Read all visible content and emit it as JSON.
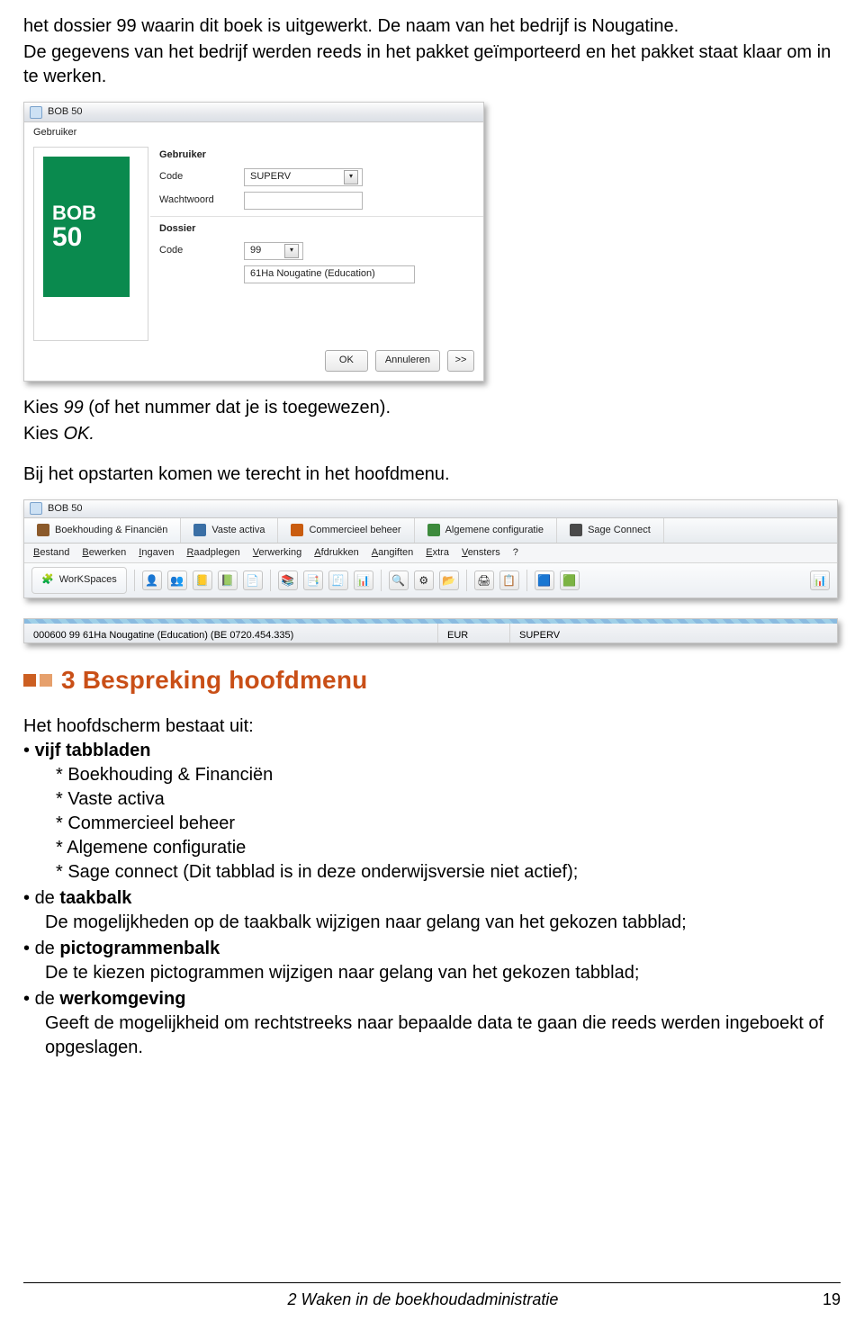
{
  "intro": {
    "line1": "het dossier 99 waarin dit boek is uitgewerkt. De naam van het bedrijf is Nougatine.",
    "line2": "De gegevens van het bedrijf werden reeds in het pakket geïmporteerd en het pakket staat klaar om in te werken."
  },
  "login": {
    "window_title": "BOB 50",
    "logo_top": "BOB",
    "logo_bottom": "50",
    "group_user": "Gebruiker",
    "lbl_code": "Code",
    "val_user_code": "SUPERV",
    "lbl_pwd": "Wachtwoord",
    "val_pwd": "",
    "group_dossier": "Dossier",
    "val_dossier_code": "99",
    "val_dossier_desc": "61Ha Nougatine (Education)",
    "btn_ok": "OK",
    "btn_cancel": "Annuleren",
    "btn_more": ">>"
  },
  "mid": {
    "line1a": "Kies ",
    "line1b": "99",
    "line1c": " (of het nummer dat je is toegewezen).",
    "line2a": "Kies ",
    "line2b": "OK.",
    "line3": "Bij het opstarten komen we terecht in het hoofdmenu."
  },
  "toolbar": {
    "window_title": "BOB 50",
    "tabs": [
      "Boekhouding & Financiën",
      "Vaste activa",
      "Commercieel beheer",
      "Algemene configuratie",
      "Sage Connect"
    ],
    "menus": [
      "Bestand",
      "Bewerken",
      "Ingaven",
      "Raadplegen",
      "Verwerking",
      "Afdrukken",
      "Aangiften",
      "Extra",
      "Vensters",
      "?"
    ],
    "workspaces": "WorKSpaces"
  },
  "statusbar": {
    "left": "000600   99  61Ha Nougatine (Education) (BE 0720.454.335)",
    "mid": "EUR",
    "right": "SUPERV"
  },
  "section": {
    "title": "3 Bespreking hoofdmenu",
    "lead": "Het hoofdscherm bestaat uit:",
    "b1": "vijf tabbladen",
    "s1": "Boekhouding & Financiën",
    "s2": "Vaste activa",
    "s3": "Commercieel beheer",
    "s4": "Algemene configuratie",
    "s5": "Sage connect (Dit tabblad is in deze onderwijsversie niet actief);",
    "b2a": "de ",
    "b2b": "taakbalk",
    "b2line": "De mogelijkheden op de taakbalk wijzigen naar gelang van het gekozen tabblad;",
    "b3a": "de ",
    "b3b": "pictogrammenbalk",
    "b3line": "De te kiezen pictogrammen wijzigen naar gelang van het gekozen tabblad;",
    "b4a": "de ",
    "b4b": "werkomgeving",
    "b4line": "Geeft de mogelijkheid om rechtstreeks naar bepaalde data te gaan die reeds werden ingeboekt of opgeslagen."
  },
  "footer": {
    "chapter": "2  Waken in de boekhoudadministratie",
    "page": "19"
  }
}
